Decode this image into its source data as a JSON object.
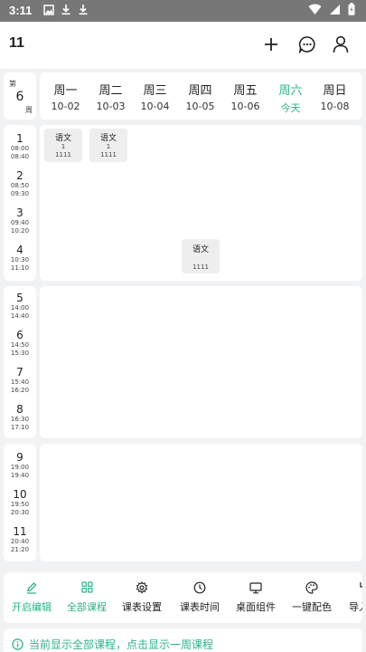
{
  "status_bar": {
    "time": "3:11",
    "icons": [
      "gallery-icon",
      "download-icon",
      "download-icon",
      "wifi-icon",
      "signal-icon",
      "battery-icon"
    ]
  },
  "app_bar": {
    "title": "11",
    "actions": [
      "add-icon",
      "chat-icon",
      "profile-icon"
    ]
  },
  "week": {
    "prefix": "第",
    "number": "6",
    "suffix": "周"
  },
  "days": [
    {
      "name": "周一",
      "date": "10-02"
    },
    {
      "name": "周二",
      "date": "10-03"
    },
    {
      "name": "周三",
      "date": "10-04"
    },
    {
      "name": "周四",
      "date": "10-05"
    },
    {
      "name": "周五",
      "date": "10-06"
    },
    {
      "name": "周六",
      "date": "今天",
      "today": true
    },
    {
      "name": "周日",
      "date": "10-08"
    }
  ],
  "periods": [
    {
      "num": "1",
      "start": "08:00",
      "end": "08:40"
    },
    {
      "num": "2",
      "start": "08:50",
      "end": "09:30"
    },
    {
      "num": "3",
      "start": "09:40",
      "end": "10:20"
    },
    {
      "num": "4",
      "start": "10:30",
      "end": "11:10"
    },
    {
      "num": "5",
      "start": "14:00",
      "end": "14:40"
    },
    {
      "num": "6",
      "start": "14:50",
      "end": "15:30"
    },
    {
      "num": "7",
      "start": "15:40",
      "end": "16:20"
    },
    {
      "num": "8",
      "start": "16:30",
      "end": "17:10"
    },
    {
      "num": "9",
      "start": "19:00",
      "end": "19:40"
    },
    {
      "num": "10",
      "start": "19:50",
      "end": "20:30"
    },
    {
      "num": "11",
      "start": "20:40",
      "end": "21:20"
    }
  ],
  "courses": [
    {
      "name": "语文",
      "line1": "1",
      "line2": "1111"
    },
    {
      "name": "语文",
      "line1": "1",
      "line2": "1111"
    },
    {
      "name": "语文",
      "line1": "",
      "line2": "1111"
    }
  ],
  "toolbar": [
    {
      "label": "开启编辑",
      "icon": "edit-icon",
      "active": true
    },
    {
      "label": "全部课程",
      "icon": "grid-icon",
      "active": true
    },
    {
      "label": "课表设置",
      "icon": "gear-icon"
    },
    {
      "label": "课表时间",
      "icon": "clock-icon"
    },
    {
      "label": "桌面组件",
      "icon": "monitor-icon"
    },
    {
      "label": "一键配色",
      "icon": "palette-icon"
    },
    {
      "label": "导入",
      "icon": "import-icon"
    }
  ],
  "notice": {
    "text": "当前显示全部课程，点击显示一周课程",
    "icon": "info-icon"
  },
  "colors": {
    "accent": "#2bb38a",
    "background": "#f1f2f4",
    "card": "#ffffff",
    "course_bg": "#eeeeee"
  }
}
